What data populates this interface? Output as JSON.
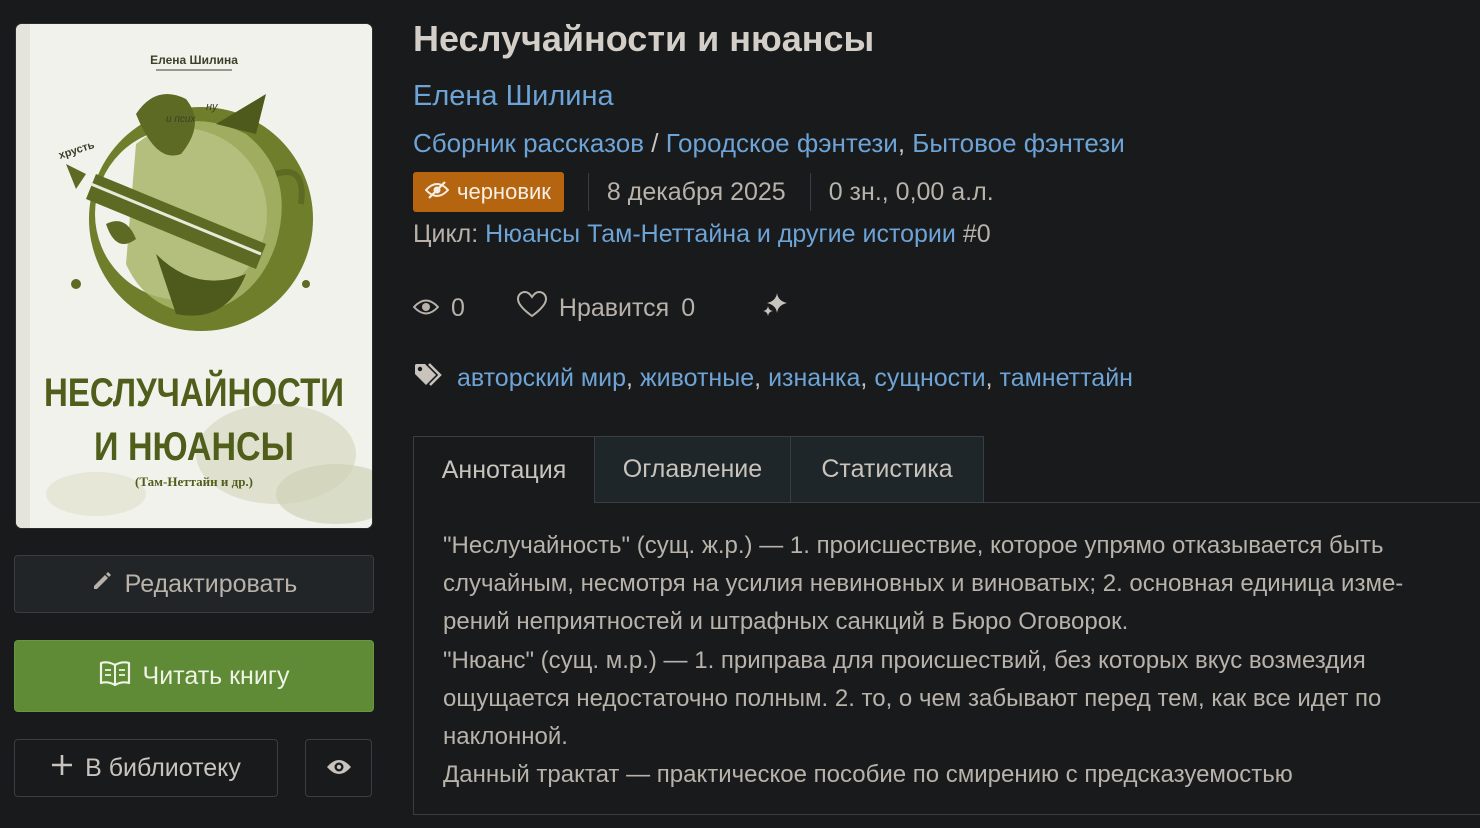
{
  "book": {
    "title": "Неслучайности и нюансы",
    "author": "Елена Шилина",
    "genres": [
      "Сборник рассказов",
      "Городское фэнтези",
      "Бытовое фэнтези"
    ],
    "genre_sep_1": "/",
    "genre_sep_2": ",",
    "status_badge": "черновик",
    "date": "8 декабря 2025",
    "size": "0 зн., 0,00 а.л.",
    "cycle_label": "Цикл:",
    "cycle_name": "Нюансы Там-Неттайна и другие истории",
    "cycle_number": "#0"
  },
  "cover": {
    "author": "Елена Шилина",
    "title_line1": "НЕСЛУЧАЙНОСТИ",
    "title_line2": "И НЮАНСЫ",
    "subtitle": "(Там-Неттайн и др.)",
    "doodle_1": "ну",
    "doodle_2": "и псих",
    "doodle_3": "хрусть",
    "colors": {
      "ink": "#5c6a23",
      "light": "#a9b56a",
      "paper": "#f2f2ec"
    }
  },
  "stats": {
    "views": "0",
    "likes_label": "Нравится",
    "likes": "0"
  },
  "tags": [
    "авторский мир",
    "животные",
    "изнанка",
    "сущности",
    "тамнеттайн"
  ],
  "tag_sep": ",",
  "tabs": [
    "Аннотация",
    "Оглавление",
    "Статистика"
  ],
  "annotation": [
    "\"Неслучайность\" (сущ. ж.р.) — 1. происшествие, которое упрямо отказывается быть",
    "случайным, несмотря на усилия невиновных и виноватых; 2. основная единица изме-",
    "рений неприятностей и штрафных санкций в Бюро Оговорок.",
    "\"Нюанс\" (сущ. м.р.) — 1. приправа для происшествий, без которых вкус возмездия",
    "ощущается недостаточно полным. 2. то, о чем забывают перед тем, как все идет по",
    "наклонной.",
    "Данный трактат — практическое пособие по смирению с предсказуемостью"
  ],
  "buttons": {
    "edit": "Редактировать",
    "read": "Читать книгу",
    "library": "В библиотеку"
  },
  "icons": {
    "edit": "pencil-icon",
    "read": "open-book-icon",
    "library": "plus-icon",
    "watch": "eye-icon",
    "draft": "eye-slash-icon",
    "views": "eye-icon",
    "likes": "heart-icon",
    "sparkle": "sparkles-icon",
    "tags": "tags-icon"
  },
  "colors": {
    "background": "#181a1b",
    "link": "#6ea3d6",
    "badge": "#b5650f",
    "read_button": "#5f8a36",
    "text": "#c8c3bc"
  }
}
